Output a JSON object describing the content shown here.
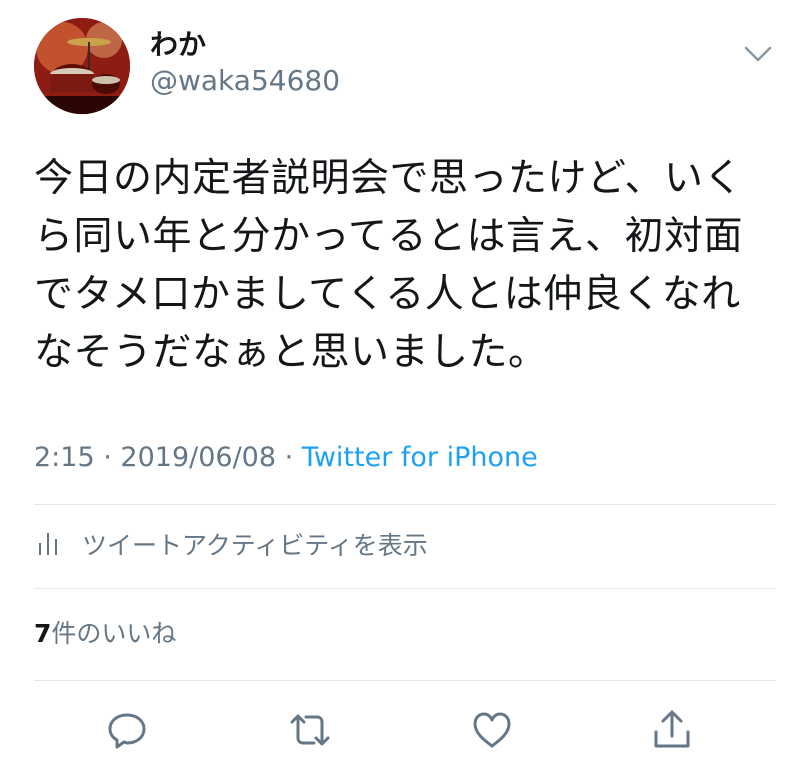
{
  "user": {
    "display_name": "わか",
    "handle": "@waka54680"
  },
  "tweet": {
    "text": "今日の内定者説明会で思ったけど、いくら同い年と分かってるとは言え、初対面でタメ口かましてくる人とは仲良くなれなそうだなぁと思いました。",
    "time": "2:15",
    "separator": "·",
    "date": "2019/06/08",
    "source": "Twitter for iPhone"
  },
  "activity": {
    "label": "ツイートアクティビティを表示"
  },
  "likes": {
    "count": "7",
    "label": "件のいいね"
  },
  "icons": {
    "caret": "chevron-down-icon",
    "activity": "bar-chart-icon",
    "reply": "reply-icon",
    "retweet": "retweet-icon",
    "like": "heart-icon",
    "share": "share-icon"
  },
  "colors": {
    "text": "#14171a",
    "secondary": "#657786",
    "link": "#1da1f2",
    "divider": "#e1e8ed"
  }
}
